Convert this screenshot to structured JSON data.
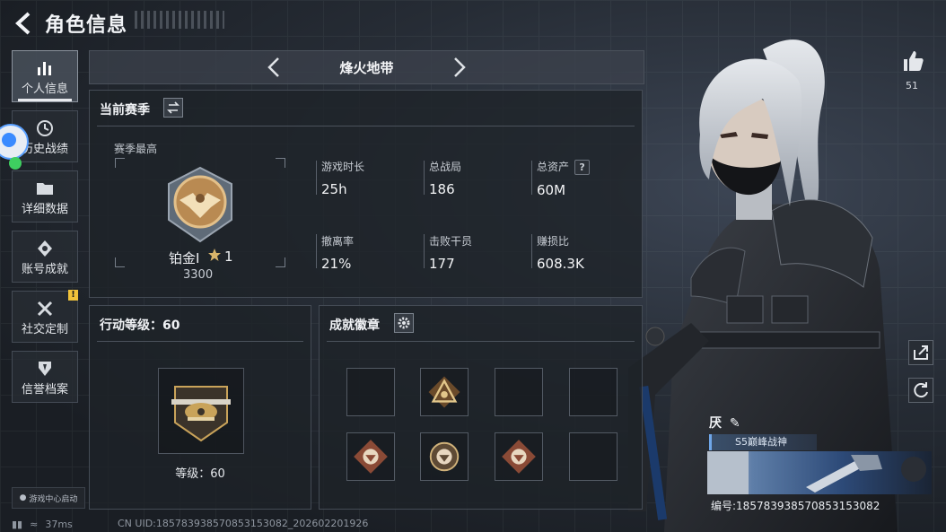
{
  "header": {
    "title": "角色信息"
  },
  "sidebar": {
    "items": [
      {
        "label": "个人信息",
        "active": true
      },
      {
        "label": "历史战绩"
      },
      {
        "label": "详细数据"
      },
      {
        "label": "账号成就"
      },
      {
        "label": "社交定制",
        "badge": "!"
      },
      {
        "label": "信誉档案"
      }
    ],
    "launch_label": "游戏中心启动"
  },
  "mode": {
    "title": "烽火地带"
  },
  "season": {
    "title": "当前赛季",
    "best_label": "赛季最高",
    "rank_name": "铂金I",
    "rank_stars": "1",
    "rank_score": "3300",
    "stats": [
      {
        "label": "游戏时长",
        "value": "25h"
      },
      {
        "label": "总战局",
        "value": "186"
      },
      {
        "label": "总资产",
        "value": "60M",
        "help": "?"
      },
      {
        "label": "撤离率",
        "value": "21%"
      },
      {
        "label": "击败干员",
        "value": "177"
      },
      {
        "label": "赚损比",
        "value": "608.3K"
      }
    ]
  },
  "level": {
    "title": "行动等级：60",
    "caption": "等级：60"
  },
  "achievements": {
    "title": "成就徽章",
    "slots": 8
  },
  "profile": {
    "likes": "51",
    "name": "厌",
    "title_tag": "S5巅峰战神",
    "id_line": "编号:18578393857085315308​2"
  },
  "status": {
    "ping": "37ms",
    "uid": "CN UID:18578393857085315308​2_202602201926"
  },
  "colors": {
    "accent_gold": "#c9a35a",
    "bronze": "#a36a3f",
    "badge_warn": "#f0c23a"
  }
}
